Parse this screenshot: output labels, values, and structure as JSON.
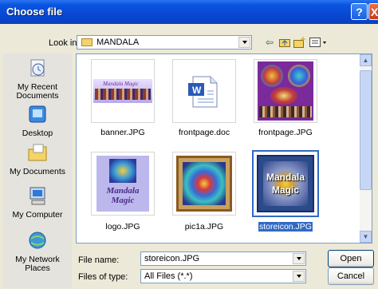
{
  "window": {
    "title": "Choose file"
  },
  "titlebar": {
    "help_label": "?",
    "close_label": "X"
  },
  "lookin": {
    "label": "Look in:",
    "value": "MANDALA"
  },
  "places": [
    {
      "label": "My Recent Documents",
      "icon": "recent-documents-icon"
    },
    {
      "label": "Desktop",
      "icon": "desktop-icon"
    },
    {
      "label": "My Documents",
      "icon": "my-documents-icon"
    },
    {
      "label": "My Computer",
      "icon": "my-computer-icon"
    },
    {
      "label": "My Network Places",
      "icon": "network-places-icon"
    }
  ],
  "files": [
    {
      "name": "banner.JPG",
      "kind": "image",
      "thumb_text": "Mandala Magic"
    },
    {
      "name": "frontpage.doc",
      "kind": "document",
      "thumb_text": "W"
    },
    {
      "name": "frontpage.JPG",
      "kind": "image",
      "thumb_text": ""
    },
    {
      "name": "logo.JPG",
      "kind": "image",
      "thumb_text": "Mandala Magic"
    },
    {
      "name": "pic1a.JPG",
      "kind": "image",
      "thumb_text": ""
    },
    {
      "name": "storeicon.JPG",
      "kind": "image",
      "selected": true,
      "thumb_text": "Mandala Magic"
    }
  ],
  "filename": {
    "label": "File name:",
    "value": "storeicon.JPG"
  },
  "filetype": {
    "label": "Files of type:",
    "value": "All Files (*.*)"
  },
  "buttons": {
    "open": "Open",
    "cancel": "Cancel"
  },
  "colors": {
    "titlebar": "#0a55e0",
    "selection": "#316ac5",
    "dialog": "#ece9d8"
  }
}
